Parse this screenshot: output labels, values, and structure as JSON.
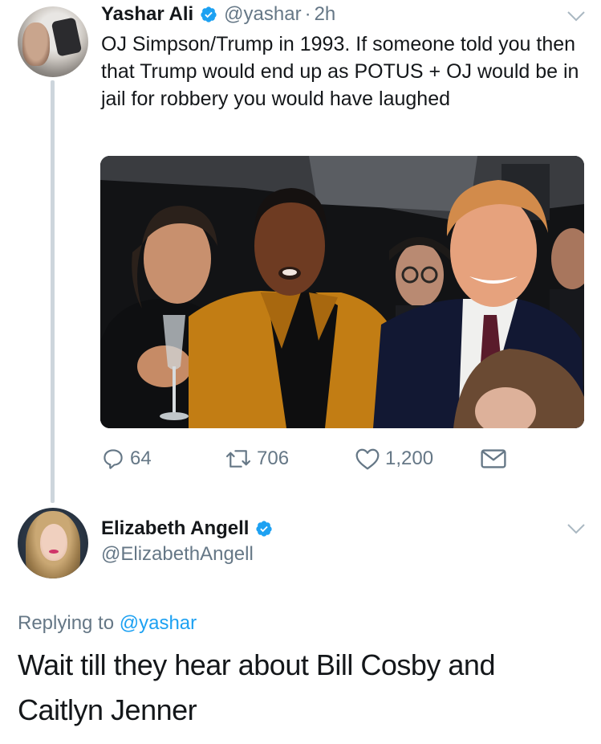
{
  "original_tweet": {
    "author_name": "Yashar Ali",
    "handle": "@yashar",
    "separator": "·",
    "time": "2h",
    "text": "OJ Simpson/Trump in 1993. If someone told you then that Trump would end up as POTUS + OJ would be in jail for robbery you would have laughed",
    "actions": {
      "replies": "64",
      "retweets": "706",
      "likes": "1,200"
    }
  },
  "reply_tweet": {
    "author_name": "Elizabeth Angell",
    "handle": "@ElizabethAngell",
    "replying_prefix": "Replying to",
    "replying_to": "@yashar",
    "text": "Wait till they hear about Bill Cosby and Caitlyn Jenner"
  },
  "colors": {
    "verified_blue": "#1da1f2",
    "link_blue": "#1da1f2",
    "muted_gray": "#657786",
    "thread_line": "#cdd5dc"
  },
  "icons": {
    "verified": "verified-badge-icon",
    "chevron": "chevron-down-icon",
    "reply": "reply-icon",
    "retweet": "retweet-icon",
    "like": "heart-icon",
    "message": "envelope-icon"
  }
}
